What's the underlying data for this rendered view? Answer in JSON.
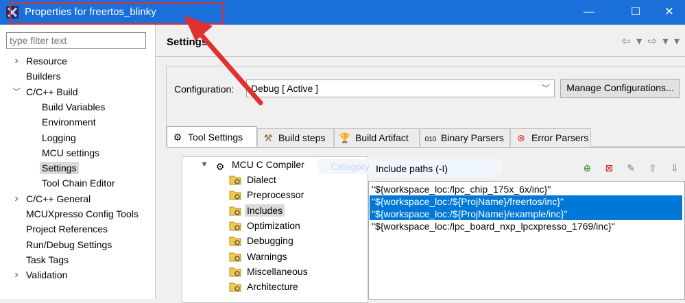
{
  "window": {
    "title": "Properties for freertos_blinky",
    "minimize_glyph": "—",
    "maximize_glyph": "☐",
    "close_glyph": "✕"
  },
  "left_panel": {
    "filter_placeholder": "type filter text",
    "items": [
      {
        "label": "Resource",
        "level": 0,
        "twisty": "right"
      },
      {
        "label": "Builders",
        "level": 0,
        "twisty": "none"
      },
      {
        "label": "C/C++ Build",
        "level": 0,
        "twisty": "down"
      },
      {
        "label": "Build Variables",
        "level": 1,
        "twisty": "none"
      },
      {
        "label": "Environment",
        "level": 1,
        "twisty": "none"
      },
      {
        "label": "Logging",
        "level": 1,
        "twisty": "none"
      },
      {
        "label": "MCU settings",
        "level": 1,
        "twisty": "none"
      },
      {
        "label": "Settings",
        "level": 1,
        "twisty": "none",
        "selected": true
      },
      {
        "label": "Tool Chain Editor",
        "level": 1,
        "twisty": "none"
      },
      {
        "label": "C/C++ General",
        "level": 0,
        "twisty": "right"
      },
      {
        "label": "MCUXpresso Config Tools",
        "level": 0,
        "twisty": "none"
      },
      {
        "label": "Project References",
        "level": 0,
        "twisty": "none"
      },
      {
        "label": "Run/Debug Settings",
        "level": 0,
        "twisty": "none"
      },
      {
        "label": "Task Tags",
        "level": 0,
        "twisty": "none"
      },
      {
        "label": "Validation",
        "level": 0,
        "twisty": "right"
      }
    ]
  },
  "main": {
    "heading": "Settings",
    "nav_glyphs": "⇦ ▾ ⇨ ▾ ▾",
    "configuration_label": "Configuration:",
    "configuration_value": "Debug  [ Active ]",
    "manage_button": "Manage Configurations...",
    "tabs": [
      {
        "label": "Tool Settings",
        "icon": "gear-icon",
        "active": true
      },
      {
        "label": "Build steps",
        "icon": "hammer-icon"
      },
      {
        "label": "Build Artifact",
        "icon": "trophy-icon"
      },
      {
        "label": "Binary Parsers",
        "icon": "binary-icon"
      },
      {
        "label": "Error Parsers",
        "icon": "error-icon"
      }
    ],
    "tool_tree": {
      "root": "MCU C Compiler",
      "children": [
        "Dialect",
        "Preprocessor",
        "Includes",
        "Optimization",
        "Debugging",
        "Warnings",
        "Miscellaneous",
        "Architecture"
      ],
      "selected": "Includes"
    },
    "ghost_label": "Category",
    "include_header": "Include paths (-I)",
    "include_paths": [
      {
        "path": "\"${workspace_loc:/lpc_chip_175x_6x/inc}\"",
        "selected": false
      },
      {
        "path": "\"${workspace_loc:/${ProjName}/freertos/inc}\"",
        "selected": true
      },
      {
        "path": "\"${workspace_loc:/${ProjName}/example/inc}\"",
        "selected": true
      },
      {
        "path": "\"${workspace_loc:/lpc_board_nxp_lpcxpresso_1769/inc}\"",
        "selected": false
      }
    ]
  },
  "colors": {
    "titlebar": "#1a6fd8",
    "selection": "#0078d7",
    "annotation": "#e03030"
  }
}
